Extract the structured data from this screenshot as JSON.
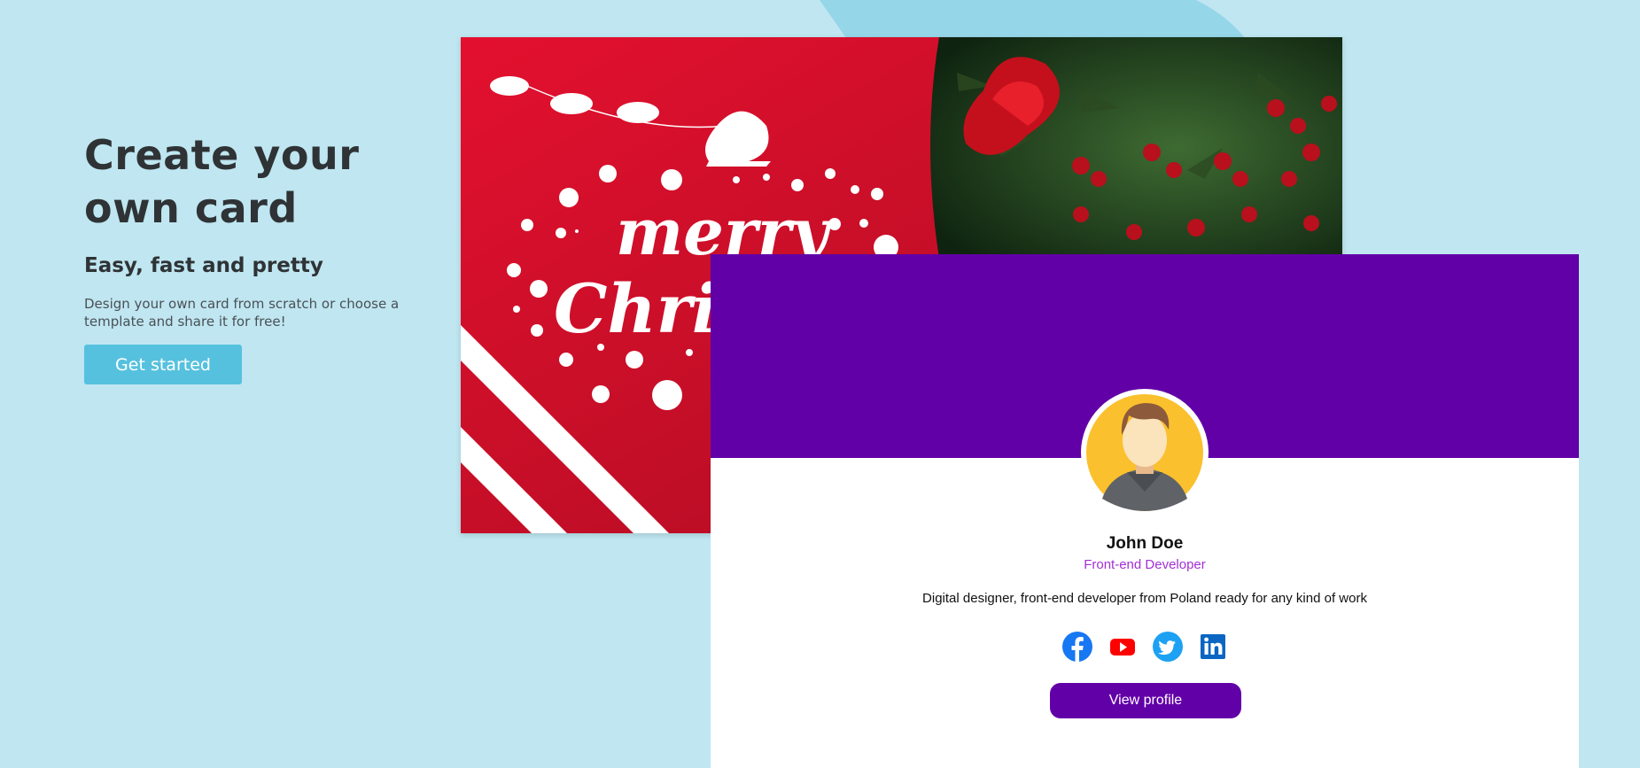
{
  "hero": {
    "title_line1": "Create your",
    "title_line2": "own card",
    "subtitle": "Easy, fast and pretty",
    "description": "Design your own card from scratch or choose a template and share it for free!",
    "cta_label": "Get started"
  },
  "xmas_card": {
    "greeting_line1": "merry",
    "greeting_line2": "Christmas"
  },
  "profile": {
    "name": "John Doe",
    "role": "Front-end Developer",
    "bio": "Digital designer, front-end developer from Poland ready for any kind of work",
    "button_label": "View profile",
    "socials": [
      "facebook-icon",
      "youtube-icon",
      "twitter-icon",
      "linkedin-icon"
    ]
  },
  "colors": {
    "page_bg": "#bfe6f1",
    "accent": "#56c1df",
    "banner": "#6200a8",
    "role_text": "#a22fd6"
  }
}
